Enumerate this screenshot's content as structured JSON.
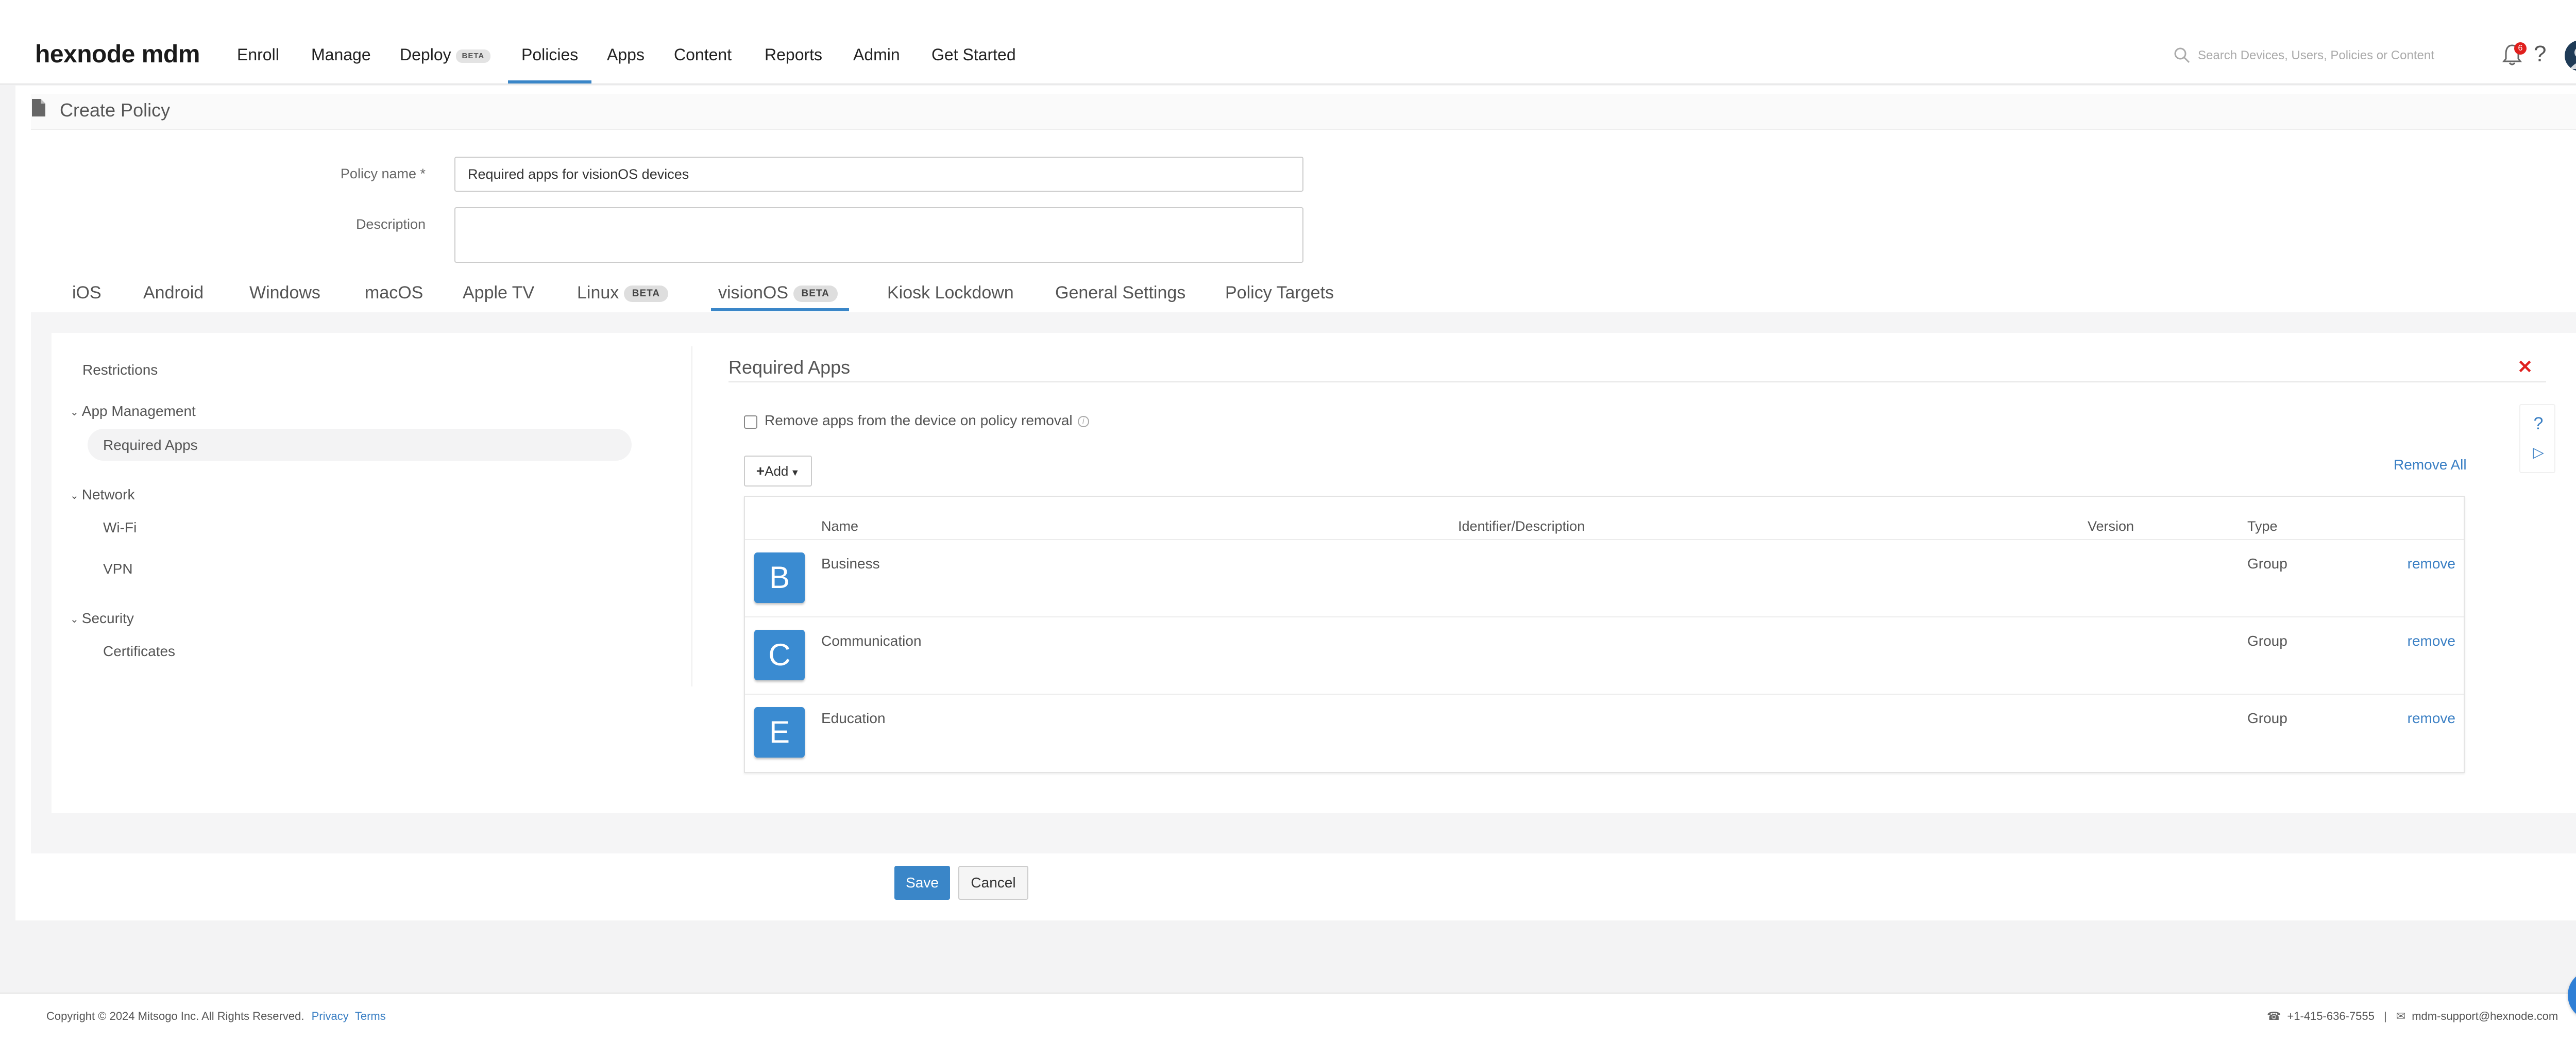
{
  "header": {
    "logo": "hexnode mdm",
    "nav": [
      {
        "label": "Enroll"
      },
      {
        "label": "Manage"
      },
      {
        "label": "Deploy",
        "badge": "BETA"
      },
      {
        "label": "Policies",
        "active": true
      },
      {
        "label": "Apps"
      },
      {
        "label": "Content"
      },
      {
        "label": "Reports"
      },
      {
        "label": "Admin"
      },
      {
        "label": "Get Started"
      }
    ],
    "search_placeholder": "Search Devices, Users, Policies or Content",
    "notification_count": "6",
    "icons": [
      "search-icon",
      "bell-icon",
      "help-icon",
      "avatar"
    ],
    "accent_color": "#3a86c8"
  },
  "page": {
    "title": "Create Policy"
  },
  "form": {
    "policy_name_label": "Policy name *",
    "policy_name_value": "Required apps for visionOS devices",
    "description_label": "Description",
    "description_value": ""
  },
  "os_tabs": [
    {
      "label": "iOS"
    },
    {
      "label": "Android"
    },
    {
      "label": "Windows"
    },
    {
      "label": "macOS"
    },
    {
      "label": "Apple TV"
    },
    {
      "label": "Linux",
      "badge": "BETA"
    },
    {
      "label": "visionOS",
      "badge": "BETA",
      "active": true
    },
    {
      "label": "Kiosk Lockdown"
    },
    {
      "label": "General Settings"
    },
    {
      "label": "Policy Targets"
    }
  ],
  "sidebar": {
    "restrictions": "Restrictions",
    "groups": [
      {
        "label": "App Management",
        "items": [
          "Required Apps"
        ]
      },
      {
        "label": "Network",
        "items": [
          "Wi-Fi",
          "VPN"
        ]
      },
      {
        "label": "Security",
        "items": [
          "Certificates"
        ]
      }
    ],
    "active_item": "Required Apps"
  },
  "section": {
    "title": "Required Apps",
    "remove_on_policy_removal_label": "Remove apps from the device on policy removal",
    "remove_on_policy_removal_checked": false,
    "add_label": "Add",
    "remove_all_label": "Remove All",
    "table": {
      "columns": [
        "Name",
        "Identifier/Description",
        "Version",
        "Type"
      ],
      "rows": [
        {
          "letter": "B",
          "name": "Business",
          "type": "Group",
          "action": "remove"
        },
        {
          "letter": "C",
          "name": "Communication",
          "type": "Group",
          "action": "remove"
        },
        {
          "letter": "E",
          "name": "Education",
          "type": "Group",
          "action": "remove"
        }
      ]
    }
  },
  "buttons": {
    "save": "Save",
    "cancel": "Cancel"
  },
  "footer": {
    "copyright": "Copyright © 2024 Mitsogo Inc. All Rights Reserved.",
    "privacy": "Privacy",
    "terms": "Terms",
    "phone": "+1-415-636-7555",
    "separator": "|",
    "email": "mdm-support@hexnode.com"
  }
}
